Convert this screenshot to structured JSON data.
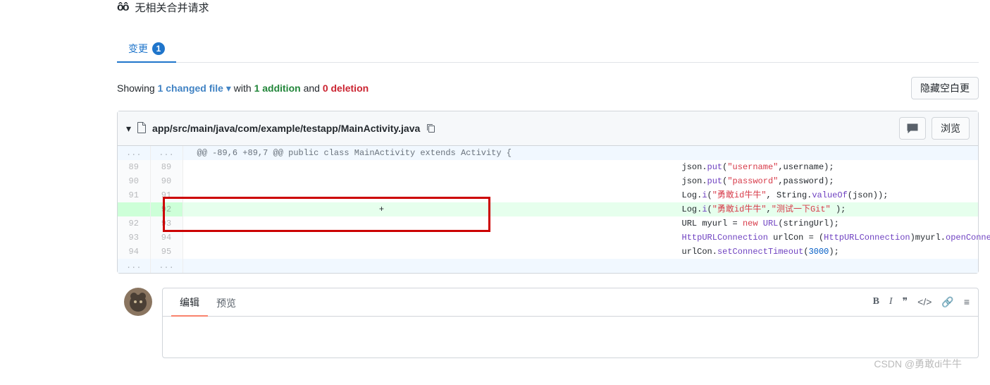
{
  "header": {
    "related_pr_text": "无相关合并请求",
    "branch_icon": "ôô"
  },
  "tabs": {
    "changes_label": "变更",
    "changes_count": "1"
  },
  "summary": {
    "showing": "Showing ",
    "file_count": "1 changed file",
    "with": "  with ",
    "additions": "1 addition",
    "and_text": " and ",
    "deletions": "0 deletion",
    "hide_whitespace_btn": "隐藏空白更"
  },
  "file": {
    "path": "app/src/main/java/com/example/testapp/MainActivity.java",
    "browse_btn": "浏览"
  },
  "diff": {
    "hunk_header": "@@ -89,6 +89,7 @@ public class MainActivity extends Activity {",
    "rows": [
      {
        "old": "89",
        "new": "89",
        "sign": " ",
        "type": "ctx"
      },
      {
        "old": "90",
        "new": "90",
        "sign": " ",
        "type": "ctx"
      },
      {
        "old": "91",
        "new": "91",
        "sign": " ",
        "type": "ctx"
      },
      {
        "old": "",
        "new": "92",
        "sign": "+",
        "type": "add"
      },
      {
        "old": "92",
        "new": "93",
        "sign": " ",
        "type": "ctx"
      },
      {
        "old": "93",
        "new": "94",
        "sign": " ",
        "type": "ctx"
      },
      {
        "old": "94",
        "new": "95",
        "sign": " ",
        "type": "ctx"
      }
    ],
    "expand_label": "..."
  },
  "code": {
    "l0_pre": "                    json.",
    "l0_fn": "put",
    "l0_p1": "(",
    "l0_s1": "\"username\"",
    "l0_c": ",username);",
    "l1_pre": "                    json.",
    "l1_fn": "put",
    "l1_p1": "(",
    "l1_s1": "\"password\"",
    "l1_c": ",password);",
    "l2_pre": "                    Log.",
    "l2_fn": "i",
    "l2_p1": "(",
    "l2_s1": "\"勇敢id牛牛\"",
    "l2_mid": ", String.",
    "l2_fn2": "valueOf",
    "l2_c": "(json));",
    "l3_pre": "                    Log.",
    "l3_fn": "i",
    "l3_p1": "(",
    "l3_s1": "\"勇敢id牛牛\"",
    "l3_c": ",",
    "l3_s2": "\"测试一下Git\"",
    "l3_end": " );",
    "l4_pre": "                    URL myurl = ",
    "l4_kw": "new",
    "l4_sp": " ",
    "l4_ty": "URL",
    "l4_c": "(stringUrl);",
    "l5_pre": "                    ",
    "l5_ty1": "HttpURLConnection",
    "l5_mid": " urlCon = (",
    "l5_ty2": "HttpURLConnection",
    "l5_mid2": ")myurl.",
    "l5_fn": "openConnection",
    "l5_c": "();",
    "l6_pre": "                    urlCon.",
    "l6_fn": "setConnectTimeout",
    "l6_p1": "(",
    "l6_n": "3000",
    "l6_c": ");"
  },
  "editor": {
    "tab_edit": "编辑",
    "tab_preview": "预览"
  },
  "watermark": "CSDN @勇敢di牛牛"
}
